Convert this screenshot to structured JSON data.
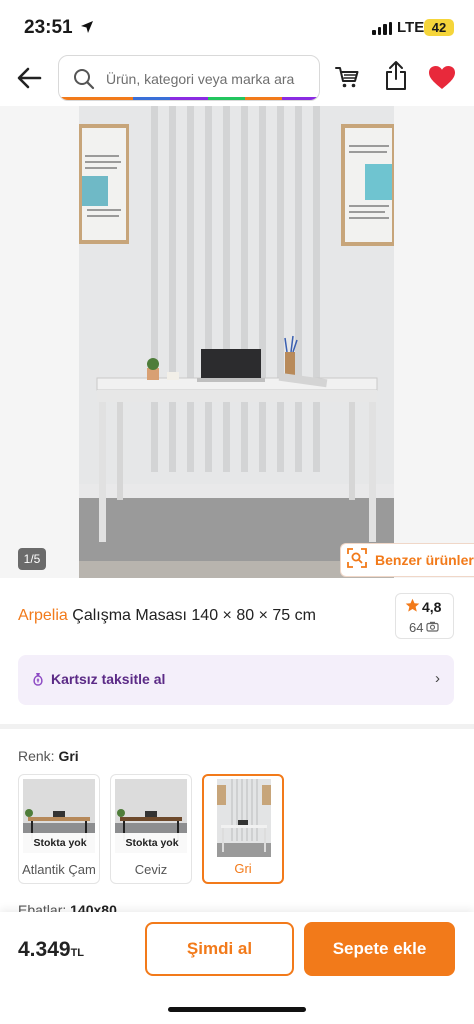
{
  "status": {
    "time": "23:51",
    "network": "LTE",
    "battery": "42"
  },
  "header": {
    "search_placeholder": "Ürün, kategori veya marka ara",
    "rainbow_colors": [
      "#f27a1a",
      "#f27a1a",
      "#3a6fd8",
      "#8a2be2",
      "#22c55e",
      "#f27a1a",
      "#8a2be2"
    ]
  },
  "gallery": {
    "counter": "1/5",
    "similar_label": "Benzer ürünler"
  },
  "product": {
    "brand": "Arpelia",
    "name": "Çalışma Masası 140 × 80 × 75 cm",
    "rating": "4,8",
    "photo_count": "64"
  },
  "installment": {
    "label": "Kartsız taksitle al"
  },
  "color": {
    "label": "Renk:",
    "selected": "Gri",
    "variants": [
      {
        "name": "Atlantik Çam",
        "stock": "Stokta yok"
      },
      {
        "name": "Ceviz",
        "stock": "Stokta yok"
      },
      {
        "name": "Gri"
      }
    ]
  },
  "size": {
    "label": "Ebatlar:",
    "selected": "140x80"
  },
  "bottom": {
    "price": "4.349",
    "currency": "TL",
    "buy_now": "Şimdi al",
    "add_to_cart": "Sepete ekle"
  },
  "colors": {
    "accent": "#f27a1a",
    "installment_bg": "#f4effa",
    "installment_text": "#5b2a86",
    "heart": "#e8293b"
  }
}
